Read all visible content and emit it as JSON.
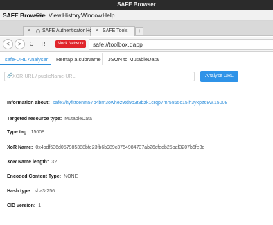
{
  "window": {
    "title": "SAFE Browser"
  },
  "menu": [
    "SAFE Browser",
    "File",
    "View",
    "History",
    "Window",
    "Help"
  ],
  "tabs": [
    {
      "label": "SAFE Authenticator Home",
      "active": false
    },
    {
      "label": "SAFE Tools",
      "active": true
    }
  ],
  "newtab_label": "+",
  "nav": {
    "back": "<",
    "forward": ">",
    "reload": "C",
    "account": "R",
    "mock_label": "Mock Network",
    "address": "safe://toolbox.dapp"
  },
  "subtabs": [
    "safe-URL Analyser",
    "Remap a subName",
    "JSON to MutableData"
  ],
  "search": {
    "placeholder": "XOR-URL / publicName-URL",
    "value": ""
  },
  "analyse_label": "Analyse URL",
  "info": [
    {
      "label": "Information about:",
      "value": "safe://hyfktcenm57p4bm3owhez9td9p3t8bzk1crqp7mr5865c15ih3yxpz68w.15008",
      "link": true
    },
    {
      "label": "Targeted resource type:",
      "value": "MutableData",
      "link": false
    },
    {
      "label": "Type tag:",
      "value": "15008",
      "link": false
    },
    {
      "label": "XoR Name:",
      "value": "0x4bdf536d057985388bfe23fb6b989c3754984737ab26cfedb25baf3207b6fe3d",
      "link": false
    },
    {
      "label": "XoR Name length:",
      "value": "32",
      "link": false
    },
    {
      "label": "Encoded Content Type:",
      "value": "NONE",
      "link": false
    },
    {
      "label": "Hash type:",
      "value": "sha3-256",
      "link": false
    },
    {
      "label": "CID version:",
      "value": "1",
      "link": false
    }
  ],
  "colors": {
    "accent": "#2f8fdb",
    "mock": "#e0262c",
    "titlebar": "#2b2b2b"
  }
}
